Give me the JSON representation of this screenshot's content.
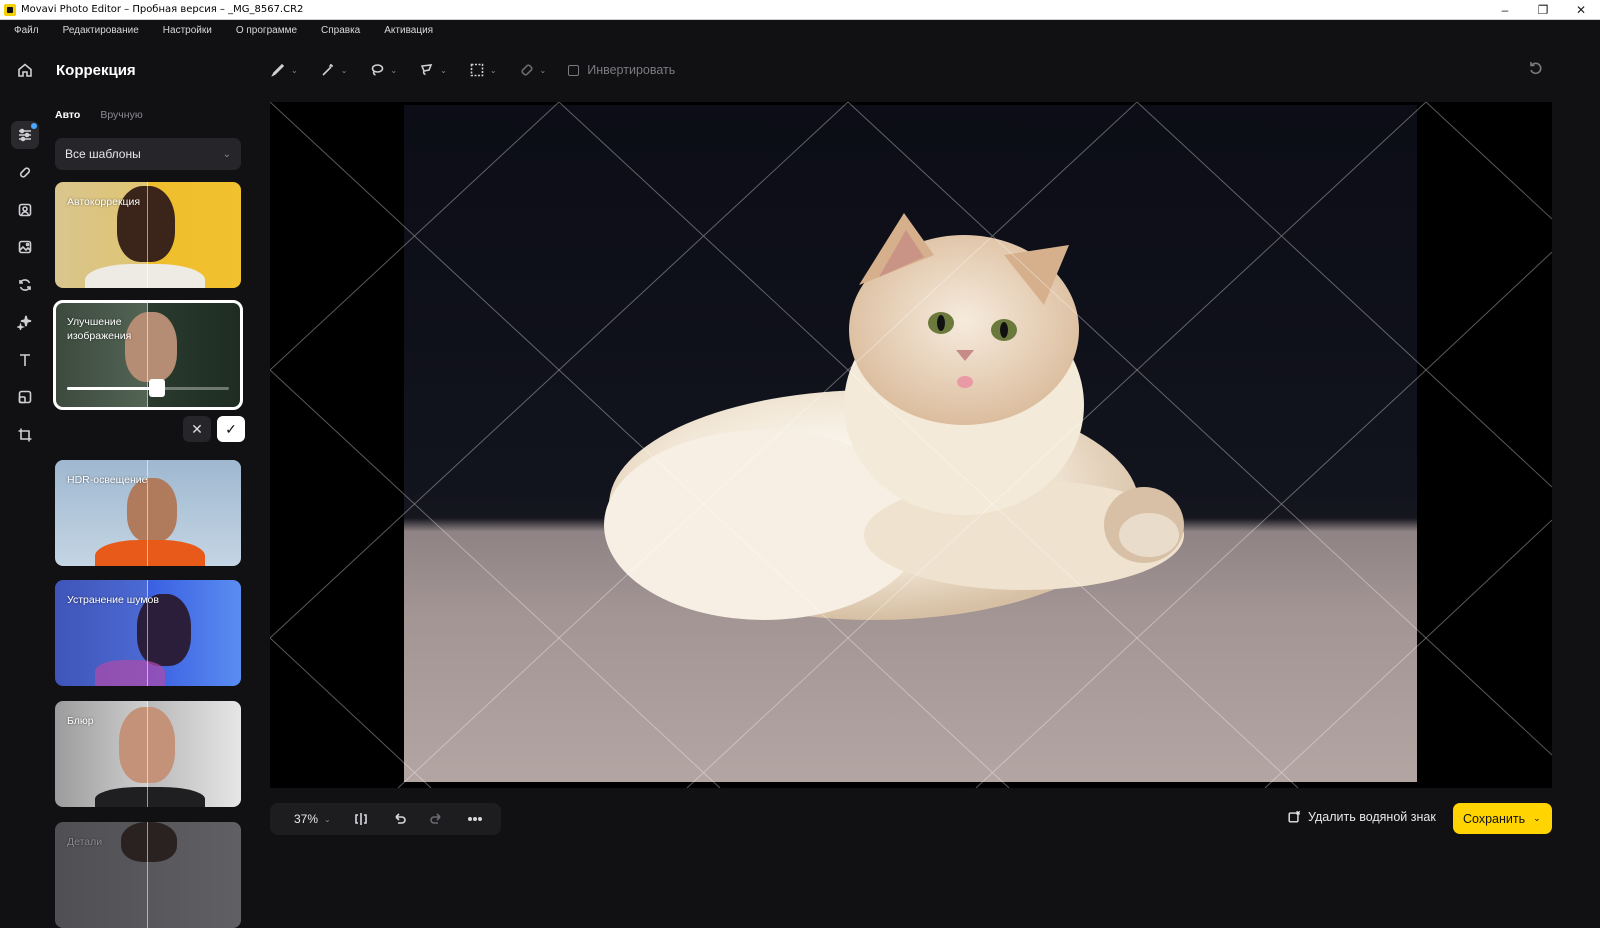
{
  "window": {
    "title": "Movavi Photo Editor – Пробная версия – _MG_8567.CR2",
    "minimize": "–",
    "maximize": "❐",
    "close": "✕"
  },
  "menu": [
    "Файл",
    "Редактирование",
    "Настройки",
    "О программе",
    "Справка",
    "Активация"
  ],
  "panel": {
    "title": "Коррекция",
    "tabs": [
      "Авто",
      "Вручную"
    ],
    "active_tab": "Авто",
    "template_select": "Все шаблоны",
    "presets": [
      {
        "label": "Автокоррекция"
      },
      {
        "label": "Улучшение изображения",
        "selected": true,
        "strength": 0.54
      },
      {
        "label": "HDR-освещение"
      },
      {
        "label": "Устранение шумов"
      },
      {
        "label": "Блюр"
      },
      {
        "label": "Детали"
      }
    ]
  },
  "toolbar": {
    "invert_label": "Инвертировать"
  },
  "bottom": {
    "zoom": "37%",
    "remove_watermark": "Удалить водяной знак",
    "save": "Сохранить"
  },
  "colors": {
    "accent": "#ffd400",
    "background": "#111113",
    "panel_input": "#26262a"
  }
}
